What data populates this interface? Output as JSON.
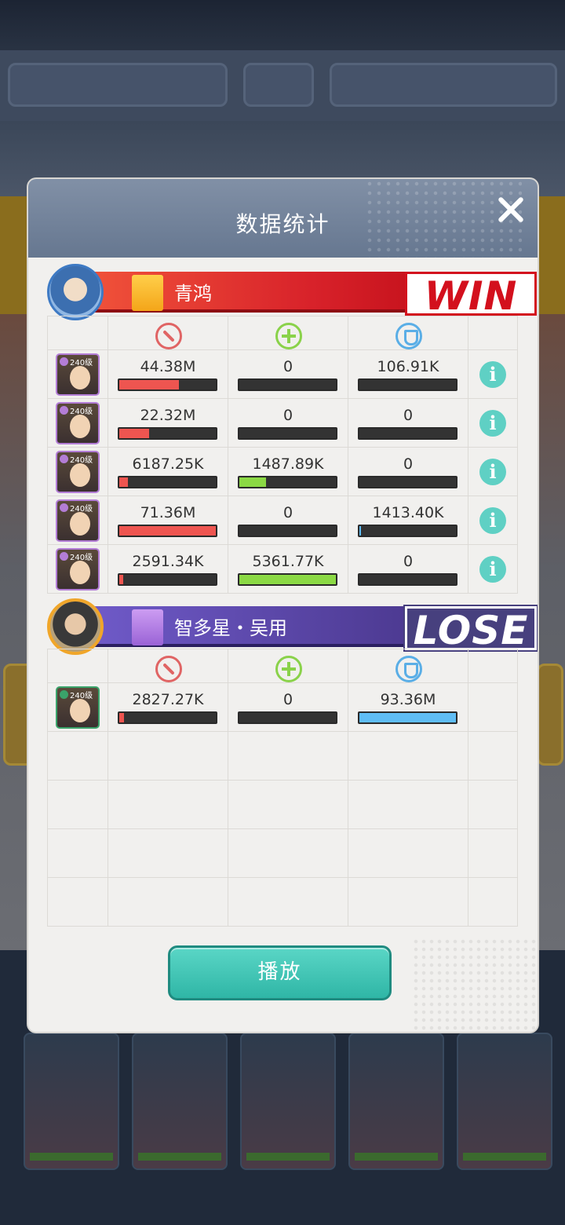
{
  "modal": {
    "title": "数据统计",
    "play_label": "播放"
  },
  "winner": {
    "team_name": "青鸿",
    "result": "WIN",
    "heroes": [
      {
        "level": "240级",
        "damage": "44.38M",
        "heal": "0",
        "shield": "106.91K",
        "frame_color": "#b37dd6",
        "damage_frac": 0.62,
        "heal_frac": 0.0,
        "shield_frac": 0.0
      },
      {
        "level": "240级",
        "damage": "22.32M",
        "heal": "0",
        "shield": "0",
        "frame_color": "#b37dd6",
        "damage_frac": 0.31,
        "heal_frac": 0.0,
        "shield_frac": 0.0
      },
      {
        "level": "240级",
        "damage": "6187.25K",
        "heal": "1487.89K",
        "shield": "0",
        "frame_color": "#b37dd6",
        "damage_frac": 0.09,
        "heal_frac": 0.28,
        "shield_frac": 0.0
      },
      {
        "level": "240级",
        "damage": "71.36M",
        "heal": "0",
        "shield": "1413.40K",
        "frame_color": "#b37dd6",
        "damage_frac": 1.0,
        "heal_frac": 0.0,
        "shield_frac": 0.02
      },
      {
        "level": "240级",
        "damage": "2591.34K",
        "heal": "5361.77K",
        "shield": "0",
        "frame_color": "#b37dd6",
        "damage_frac": 0.04,
        "heal_frac": 1.0,
        "shield_frac": 0.0
      }
    ]
  },
  "loser": {
    "team_name": "智多星・吴用",
    "result": "LOSE",
    "heroes": [
      {
        "level": "240级",
        "damage": "2827.27K",
        "heal": "0",
        "shield": "93.36M",
        "frame_color": "#3aa36a",
        "damage_frac": 0.05,
        "heal_frac": 0.0,
        "shield_frac": 1.0
      }
    ],
    "empty_rows": 4
  },
  "icons": {
    "damage": "damage-icon",
    "heal": "heal-icon",
    "shield": "shield-icon",
    "info": "info-icon",
    "close": "close-icon"
  },
  "colors": {
    "win": "#d3101d",
    "lose": "#47407e",
    "damage": "#ee5550",
    "heal": "#8bd944",
    "shield": "#5fbdf5",
    "accent": "#3bc2b2"
  }
}
